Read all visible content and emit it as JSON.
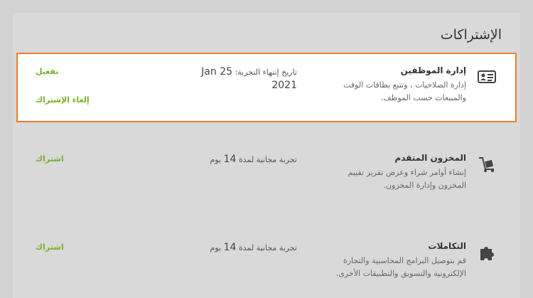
{
  "page": {
    "title": "الإشتراكات"
  },
  "colors": {
    "accent": "#7aae2a",
    "highlight": "#f07f2a"
  },
  "subscriptions": [
    {
      "icon": "id-card-icon",
      "name": "إدارة الموظفين",
      "description": "إدارة الصلاحيات ، وتتبع بطاقات الوقت والمبيعات حسب الموظف.",
      "trial_label": "تاريخ إنتهاء التجربة:",
      "trial_value": "Jan 25 2021",
      "primary_action": "تفعيل",
      "secondary_action": "إلغاء الإشتراك"
    },
    {
      "icon": "dolly-icon",
      "name": "المخزون المتقدم",
      "description": "إنشاء أوامر شراء وعرض تقرير تقييم المخزون وإدارة المخزون.",
      "trial_label": "تجربة مجانية لمدة",
      "trial_value": "14",
      "trial_unit": "يوم",
      "primary_action": "اشتراك"
    },
    {
      "icon": "puzzle-icon",
      "name": "التكاملات",
      "description": "قم بتوصيل البرامج المحاسبية والتجارة الإلكترونية والتسويق والتطبيقات الأخرى.",
      "trial_label": "تجربة مجانية لمدة",
      "trial_value": "14",
      "trial_unit": "يوم",
      "primary_action": "اشتراك"
    }
  ]
}
